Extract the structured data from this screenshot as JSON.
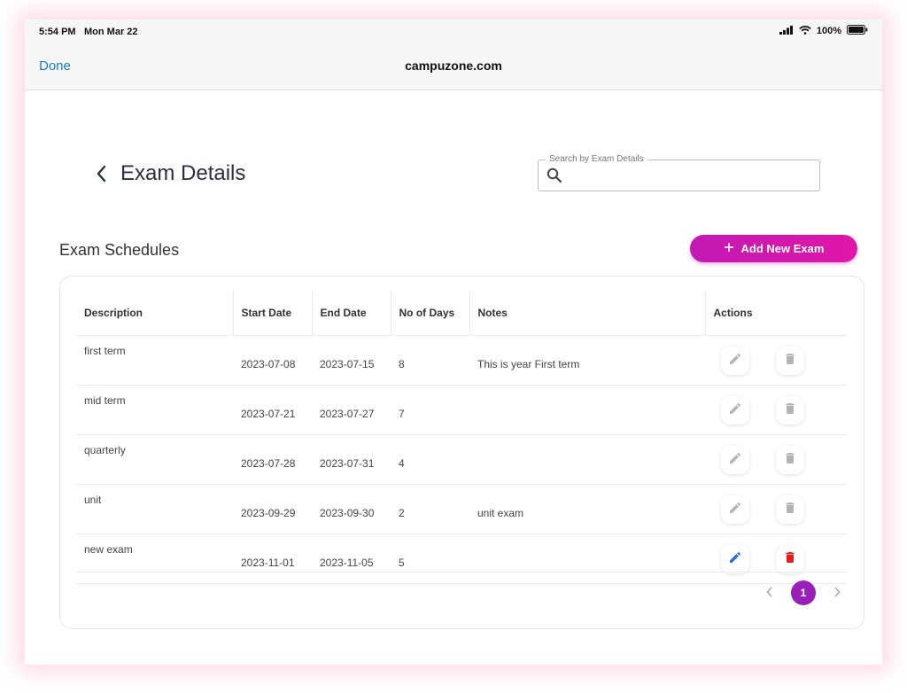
{
  "status": {
    "time": "5:54 PM",
    "date": "Mon Mar 22",
    "battery": "100%"
  },
  "browser": {
    "done_label": "Done",
    "url": "campuzone.com"
  },
  "page": {
    "title": "Exam Details"
  },
  "search": {
    "label": "Search by Exam Details",
    "placeholder": "",
    "value": ""
  },
  "section": {
    "title": "Exam Schedules",
    "add_label": "Add New Exam"
  },
  "colors": {
    "accent": "#c21ab4",
    "edit_active": "#2d6fd6",
    "delete_active": "#e81b1b",
    "inactive_icon": "#b3b3b3"
  },
  "table": {
    "columns": [
      "Description",
      "Start Date",
      "End Date",
      "No of Days",
      "Notes",
      "Actions"
    ],
    "rows": [
      {
        "description": "first term",
        "start": "2023-07-08",
        "end": "2023-07-15",
        "days": "8",
        "notes": "This is year First term"
      },
      {
        "description": "mid term",
        "start": "2023-07-21",
        "end": "2023-07-27",
        "days": "7",
        "notes": ""
      },
      {
        "description": "quarterly",
        "start": "2023-07-28",
        "end": "2023-07-31",
        "days": "4",
        "notes": ""
      },
      {
        "description": "unit",
        "start": "2023-09-29",
        "end": "2023-09-30",
        "days": "2",
        "notes": "unit exam"
      },
      {
        "description": "new exam",
        "start": "2023-11-01",
        "end": "2023-11-05",
        "days": "5",
        "notes": ""
      }
    ]
  },
  "pagination": {
    "current": "1"
  }
}
